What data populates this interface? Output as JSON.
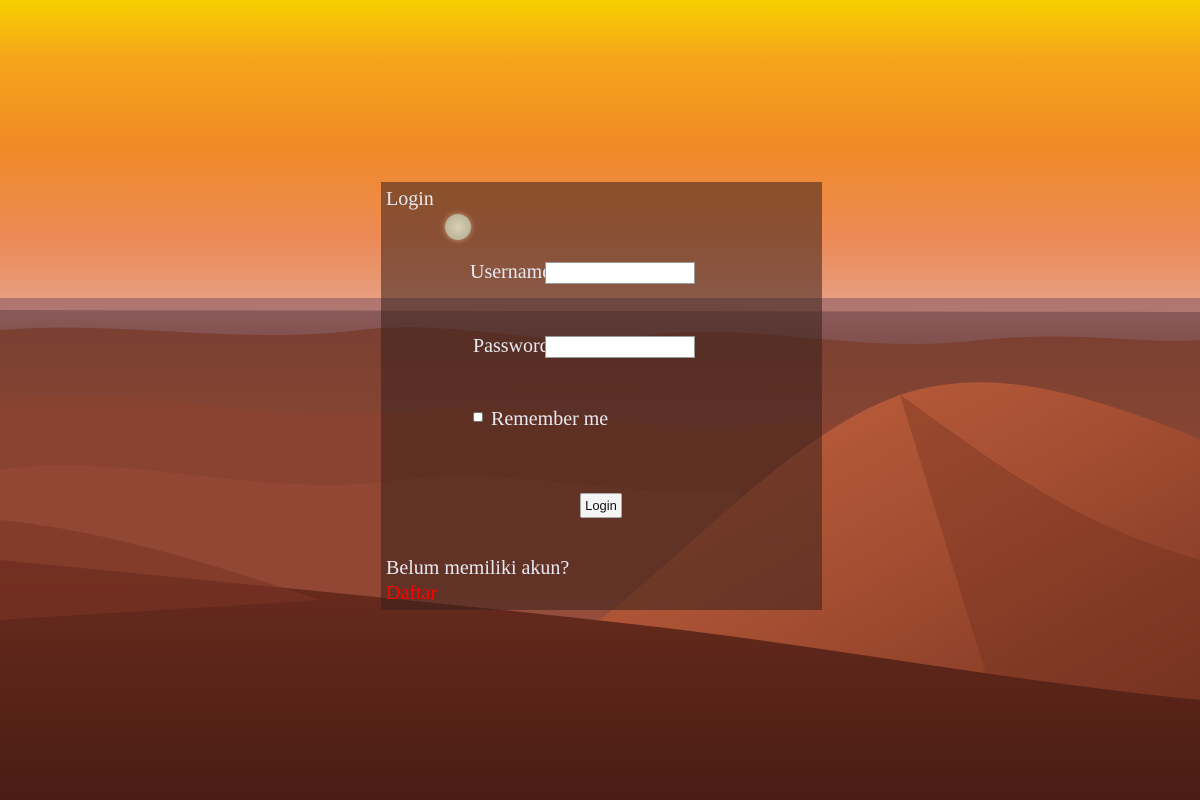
{
  "login_form": {
    "title": "Login",
    "username_label": "Username",
    "username_value": "",
    "password_label": "Password",
    "password_value": "",
    "remember_label": "Remember me",
    "remember_checked": false,
    "submit_label": "Login",
    "signup_prompt": "Belum memiliki akun?",
    "signup_link": "Daftar"
  },
  "colors": {
    "panel_overlay": "rgba(58,32,28,0.55)",
    "label_text": "#e8e8f0",
    "signup_link": "#ff0000",
    "sky_top": "#f5c400",
    "sky_mid": "#f08a20",
    "sky_horizon": "#e89a78",
    "dune_dark": "#5a2a1e",
    "dune_light": "#b45a3a"
  },
  "background": {
    "scene": "desert-sunset-dunes"
  }
}
